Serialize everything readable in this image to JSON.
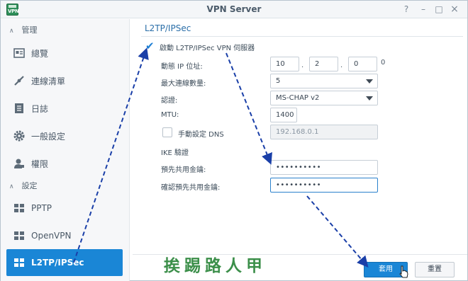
{
  "window": {
    "title": "VPN Server",
    "app_icon_label": "VPN"
  },
  "titlebar_controls": {
    "help": "?",
    "minimize": "–",
    "maximize": "□",
    "close": "×"
  },
  "sidebar": {
    "groups": [
      {
        "label": "管理",
        "chevron": "∧"
      },
      {
        "label": "設定",
        "chevron": "∧"
      }
    ],
    "items": [
      {
        "label": "總覽",
        "icon": "overview-icon"
      },
      {
        "label": "連線清單",
        "icon": "connection-list-icon"
      },
      {
        "label": "日誌",
        "icon": "log-icon"
      },
      {
        "label": "一般設定",
        "icon": "gear-icon"
      },
      {
        "label": "權限",
        "icon": "user-permission-icon"
      },
      {
        "label": "PPTP",
        "icon": "network-icon"
      },
      {
        "label": "OpenVPN",
        "icon": "network-icon"
      },
      {
        "label": "L2TP/IPSec",
        "icon": "network-icon",
        "active": true
      }
    ]
  },
  "main": {
    "section_title": "L2TP/IPSec",
    "enable_checkbox": {
      "label": "啟動 L2TP/IPSec VPN 伺服器",
      "checked": true
    },
    "dynamic_ip": {
      "label": "動態 IP 位址:",
      "octets": [
        "10",
        "2",
        "0"
      ],
      "last_octet": "0"
    },
    "max_connections": {
      "label": "最大連線數量:",
      "value": "5"
    },
    "auth": {
      "label": "認證:",
      "value": "MS-CHAP v2"
    },
    "mtu": {
      "label": "MTU:",
      "value": "1400"
    },
    "manual_dns": {
      "label": "手動設定 DNS",
      "checked": false,
      "value": "192.168.0.1"
    },
    "ike_heading": "IKE 驗證",
    "psk": {
      "label": "預先共用金鑰:",
      "value": "••••••••••"
    },
    "psk_confirm": {
      "label": "確認預先共用金鑰:",
      "value": "••••••••••"
    }
  },
  "buttons": {
    "apply": "套用",
    "reset": "重置"
  },
  "watermark": "挨踢路人甲",
  "colors": {
    "accent": "#1a86d6",
    "annotation_arrow": "#1a3fa8",
    "watermark": "#3c8f4a"
  }
}
